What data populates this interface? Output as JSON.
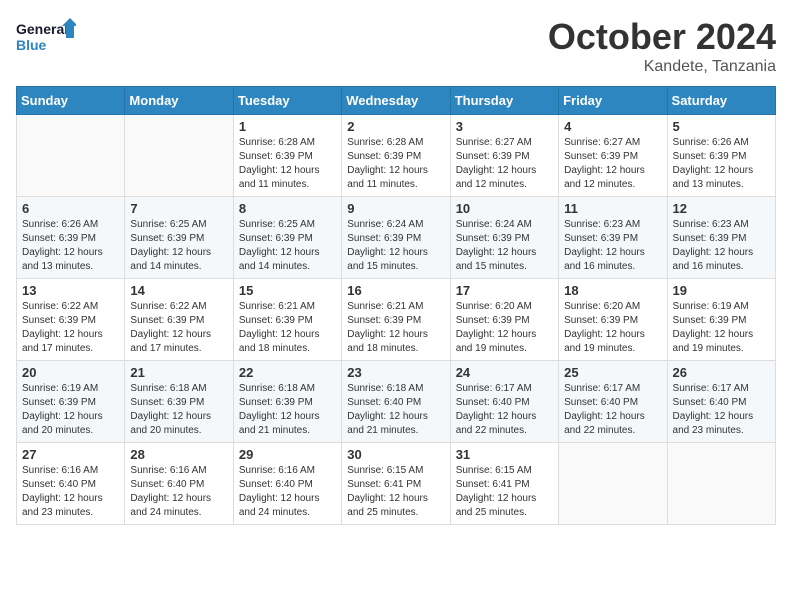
{
  "logo": {
    "line1": "General",
    "line2": "Blue"
  },
  "header": {
    "month": "October 2024",
    "location": "Kandete, Tanzania"
  },
  "weekdays": [
    "Sunday",
    "Monday",
    "Tuesday",
    "Wednesday",
    "Thursday",
    "Friday",
    "Saturday"
  ],
  "weeks": [
    [
      {
        "day": "",
        "info": ""
      },
      {
        "day": "",
        "info": ""
      },
      {
        "day": "1",
        "info": "Sunrise: 6:28 AM\nSunset: 6:39 PM\nDaylight: 12 hours and 11 minutes."
      },
      {
        "day": "2",
        "info": "Sunrise: 6:28 AM\nSunset: 6:39 PM\nDaylight: 12 hours and 11 minutes."
      },
      {
        "day": "3",
        "info": "Sunrise: 6:27 AM\nSunset: 6:39 PM\nDaylight: 12 hours and 12 minutes."
      },
      {
        "day": "4",
        "info": "Sunrise: 6:27 AM\nSunset: 6:39 PM\nDaylight: 12 hours and 12 minutes."
      },
      {
        "day": "5",
        "info": "Sunrise: 6:26 AM\nSunset: 6:39 PM\nDaylight: 12 hours and 13 minutes."
      }
    ],
    [
      {
        "day": "6",
        "info": "Sunrise: 6:26 AM\nSunset: 6:39 PM\nDaylight: 12 hours and 13 minutes."
      },
      {
        "day": "7",
        "info": "Sunrise: 6:25 AM\nSunset: 6:39 PM\nDaylight: 12 hours and 14 minutes."
      },
      {
        "day": "8",
        "info": "Sunrise: 6:25 AM\nSunset: 6:39 PM\nDaylight: 12 hours and 14 minutes."
      },
      {
        "day": "9",
        "info": "Sunrise: 6:24 AM\nSunset: 6:39 PM\nDaylight: 12 hours and 15 minutes."
      },
      {
        "day": "10",
        "info": "Sunrise: 6:24 AM\nSunset: 6:39 PM\nDaylight: 12 hours and 15 minutes."
      },
      {
        "day": "11",
        "info": "Sunrise: 6:23 AM\nSunset: 6:39 PM\nDaylight: 12 hours and 16 minutes."
      },
      {
        "day": "12",
        "info": "Sunrise: 6:23 AM\nSunset: 6:39 PM\nDaylight: 12 hours and 16 minutes."
      }
    ],
    [
      {
        "day": "13",
        "info": "Sunrise: 6:22 AM\nSunset: 6:39 PM\nDaylight: 12 hours and 17 minutes."
      },
      {
        "day": "14",
        "info": "Sunrise: 6:22 AM\nSunset: 6:39 PM\nDaylight: 12 hours and 17 minutes."
      },
      {
        "day": "15",
        "info": "Sunrise: 6:21 AM\nSunset: 6:39 PM\nDaylight: 12 hours and 18 minutes."
      },
      {
        "day": "16",
        "info": "Sunrise: 6:21 AM\nSunset: 6:39 PM\nDaylight: 12 hours and 18 minutes."
      },
      {
        "day": "17",
        "info": "Sunrise: 6:20 AM\nSunset: 6:39 PM\nDaylight: 12 hours and 19 minutes."
      },
      {
        "day": "18",
        "info": "Sunrise: 6:20 AM\nSunset: 6:39 PM\nDaylight: 12 hours and 19 minutes."
      },
      {
        "day": "19",
        "info": "Sunrise: 6:19 AM\nSunset: 6:39 PM\nDaylight: 12 hours and 19 minutes."
      }
    ],
    [
      {
        "day": "20",
        "info": "Sunrise: 6:19 AM\nSunset: 6:39 PM\nDaylight: 12 hours and 20 minutes."
      },
      {
        "day": "21",
        "info": "Sunrise: 6:18 AM\nSunset: 6:39 PM\nDaylight: 12 hours and 20 minutes."
      },
      {
        "day": "22",
        "info": "Sunrise: 6:18 AM\nSunset: 6:39 PM\nDaylight: 12 hours and 21 minutes."
      },
      {
        "day": "23",
        "info": "Sunrise: 6:18 AM\nSunset: 6:40 PM\nDaylight: 12 hours and 21 minutes."
      },
      {
        "day": "24",
        "info": "Sunrise: 6:17 AM\nSunset: 6:40 PM\nDaylight: 12 hours and 22 minutes."
      },
      {
        "day": "25",
        "info": "Sunrise: 6:17 AM\nSunset: 6:40 PM\nDaylight: 12 hours and 22 minutes."
      },
      {
        "day": "26",
        "info": "Sunrise: 6:17 AM\nSunset: 6:40 PM\nDaylight: 12 hours and 23 minutes."
      }
    ],
    [
      {
        "day": "27",
        "info": "Sunrise: 6:16 AM\nSunset: 6:40 PM\nDaylight: 12 hours and 23 minutes."
      },
      {
        "day": "28",
        "info": "Sunrise: 6:16 AM\nSunset: 6:40 PM\nDaylight: 12 hours and 24 minutes."
      },
      {
        "day": "29",
        "info": "Sunrise: 6:16 AM\nSunset: 6:40 PM\nDaylight: 12 hours and 24 minutes."
      },
      {
        "day": "30",
        "info": "Sunrise: 6:15 AM\nSunset: 6:41 PM\nDaylight: 12 hours and 25 minutes."
      },
      {
        "day": "31",
        "info": "Sunrise: 6:15 AM\nSunset: 6:41 PM\nDaylight: 12 hours and 25 minutes."
      },
      {
        "day": "",
        "info": ""
      },
      {
        "day": "",
        "info": ""
      }
    ]
  ]
}
